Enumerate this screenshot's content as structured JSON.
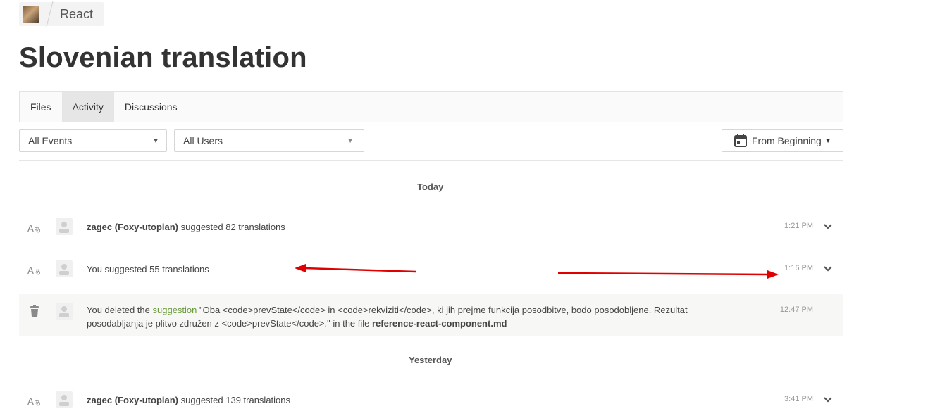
{
  "breadcrumb": {
    "project": "React"
  },
  "page_title": "Slovenian translation",
  "tabs": [
    {
      "label": "Files",
      "active": false
    },
    {
      "label": "Activity",
      "active": true
    },
    {
      "label": "Discussions",
      "active": false
    }
  ],
  "filters": {
    "events": "All Events",
    "users": "All Users",
    "date": "From Beginning"
  },
  "groups": {
    "today": "Today",
    "yesterday": "Yesterday"
  },
  "activities": [
    {
      "type_icon": "translate-icon",
      "user": "zagec (Foxy-utopian)",
      "text": " suggested 82 translations",
      "time": "1:21 PM",
      "expandable": true
    },
    {
      "type_icon": "translate-icon",
      "user": "",
      "text": "You suggested 55 translations",
      "time": "1:16 PM",
      "expandable": true
    },
    {
      "type_icon": "trash-icon",
      "text_before": "You deleted the ",
      "link": "suggestion",
      "quote": " \"Oba <code>prevState</code> in <code>rekviziti</code>, ki jih prejme funkcija posodbitve, bodo posodobljene. Rezultat posodabljanja je plitvo združen z <code>prevState</code>.\" in the file ",
      "file": "reference-react-component.md",
      "time": "12:47 PM",
      "expandable": false
    },
    {
      "type_icon": "translate-icon",
      "user": "zagec (Foxy-utopian)",
      "text": " suggested 139 translations",
      "time": "3:41 PM",
      "expandable": true
    }
  ],
  "colors": {
    "annotation_arrow": "#e00000",
    "link": "#6a9a3a",
    "active_tab": "#e6e6e6"
  }
}
